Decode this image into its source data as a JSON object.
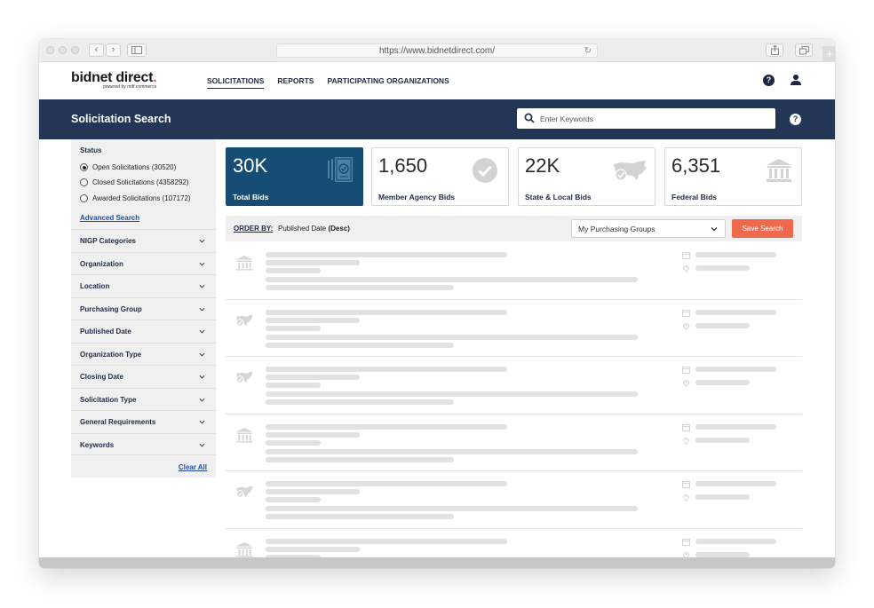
{
  "browser": {
    "url": "https://www.bidnetdirect.com/"
  },
  "brand": {
    "name": "bidnet direct",
    "dot": ".",
    "tagline": "powered by mdf commerce"
  },
  "nav": {
    "items": [
      "SOLICITATIONS",
      "REPORTS",
      "PARTICIPATING ORGANIZATIONS"
    ],
    "active": "SOLICITATIONS",
    "help": "?"
  },
  "header": {
    "title": "Solicitation Search",
    "search_placeholder": "Enter Keywords",
    "help": "?"
  },
  "sidebar": {
    "status_title": "Status",
    "status_options": [
      {
        "label": "Open Solicitations (30520)",
        "selected": true
      },
      {
        "label": "Closed Solicitations (4358292)",
        "selected": false
      },
      {
        "label": "Awarded Solicitations (107172)",
        "selected": false
      }
    ],
    "advanced_search": "Advanced Search",
    "filters": [
      "NIGP Categories",
      "Organization",
      "Location",
      "Purchasing Group",
      "Published Date",
      "Organization Type",
      "Closing Date",
      "Solicitation Type",
      "General Requirements",
      "Keywords"
    ],
    "clear_all": "Clear All"
  },
  "stats": [
    {
      "value": "30K",
      "label": "Total Bids",
      "icon": "bids-badge-icon"
    },
    {
      "value": "1,650",
      "label": "Member Agency Bids",
      "icon": "check-circle-icon"
    },
    {
      "value": "22K",
      "label": "State & Local Bids",
      "icon": "usa-map-check-icon"
    },
    {
      "value": "6,351",
      "label": "Federal Bids",
      "icon": "government-building-icon"
    }
  ],
  "order": {
    "label": "ORDER BY:",
    "field": "Published Date ",
    "direction": "(Desc)",
    "group_select": "My Purchasing Groups",
    "save_button": "Save Search"
  },
  "results": {
    "row_icons": [
      "government-building-icon",
      "usa-map-check-icon",
      "usa-map-check-icon",
      "government-building-icon",
      "usa-map-check-icon",
      "government-building-icon"
    ]
  },
  "colors": {
    "navy": "#243655",
    "primary_card": "#174d74",
    "accent": "#ef6a4c",
    "link": "#1f4fa0"
  }
}
